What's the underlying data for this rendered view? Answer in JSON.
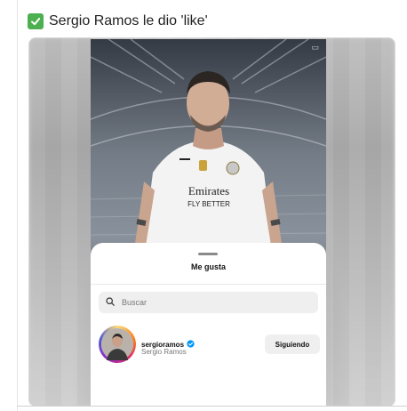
{
  "caption": {
    "emoji": "check-mark-emoji",
    "text": "Sergio Ramos le dio 'like'"
  },
  "jersey": {
    "brand": "Emirates",
    "slogan": "FLY BETTER"
  },
  "likes_sheet": {
    "title": "Me gusta",
    "search_placeholder": "Buscar",
    "user": {
      "username": "sergioramos",
      "full_name": "Sergio Ramos",
      "verified": true,
      "button_label": "Siguiendo"
    }
  },
  "colors": {
    "check": "#4caf50",
    "verified": "#0095f6",
    "jersey": "#f3f3f3"
  }
}
